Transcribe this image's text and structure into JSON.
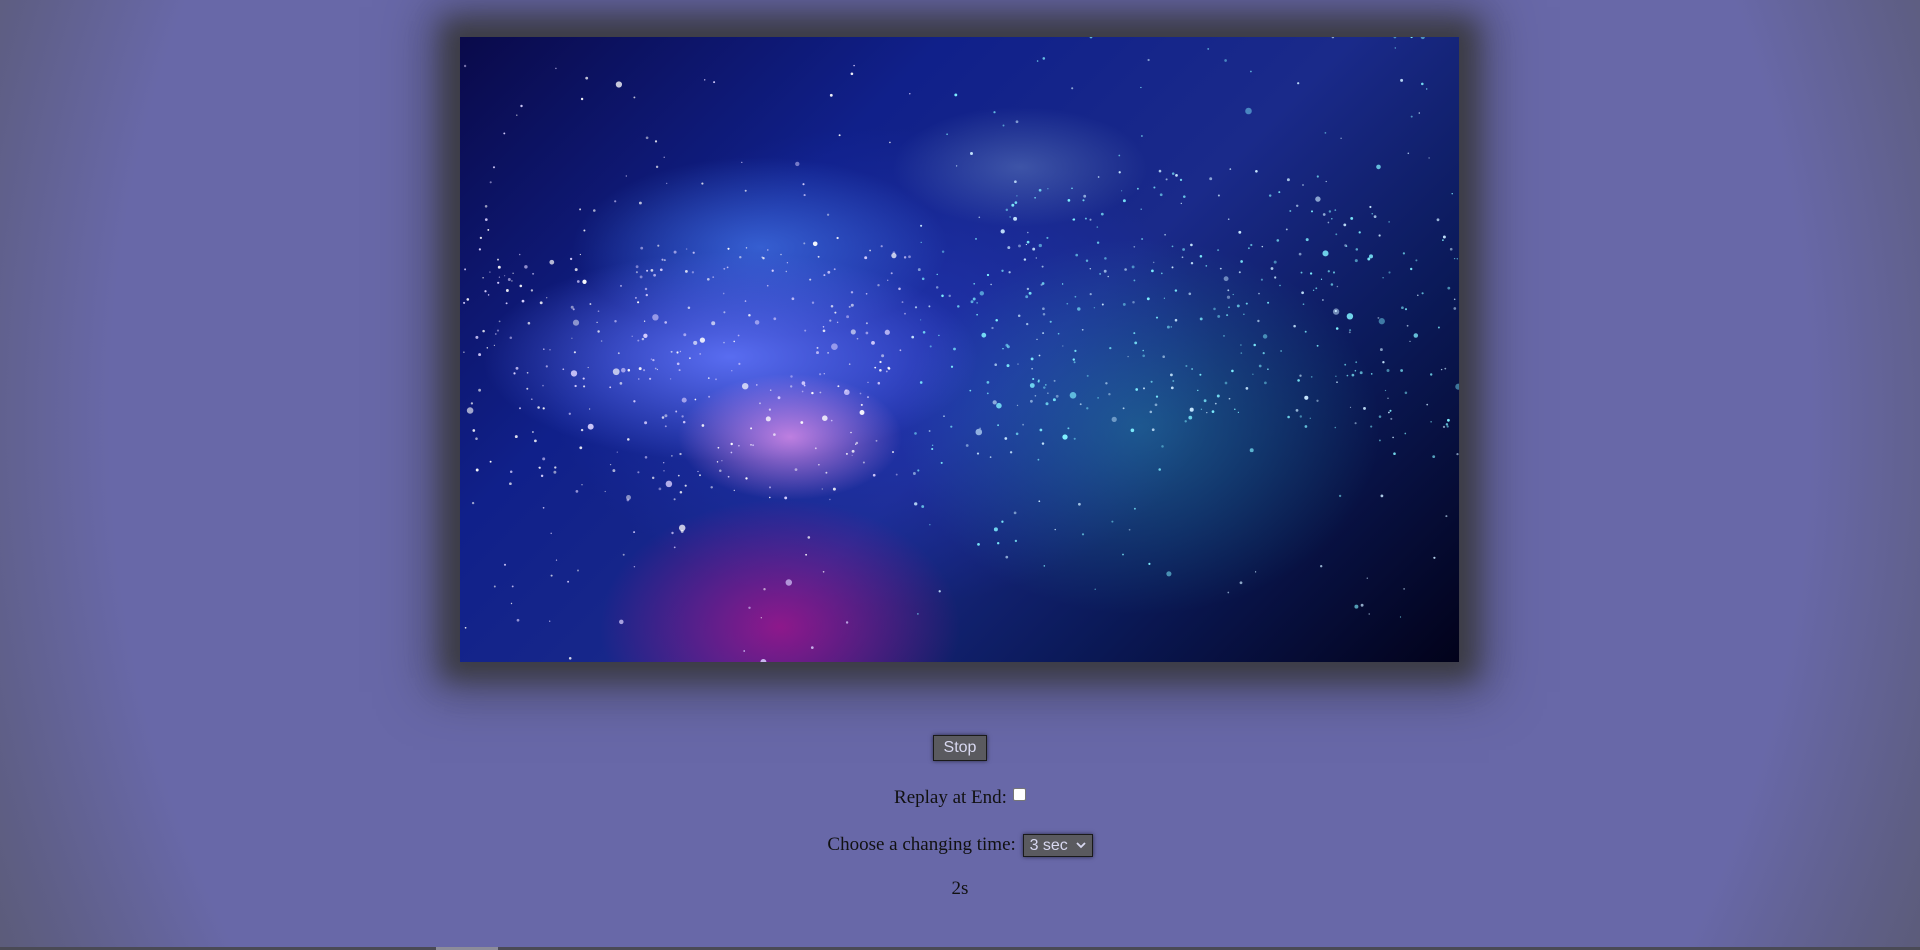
{
  "slideshow": {
    "image_alt": "",
    "stop_label": "Stop",
    "replay_label": "Replay at End:",
    "replay_checked": false,
    "time_label": "Choose a changing time:",
    "time_selected": "3 sec",
    "countdown": "2s"
  },
  "colors": {
    "page_background": "#6868a8",
    "button_background": "#5a5a5f",
    "button_text": "#d8d8f0"
  }
}
